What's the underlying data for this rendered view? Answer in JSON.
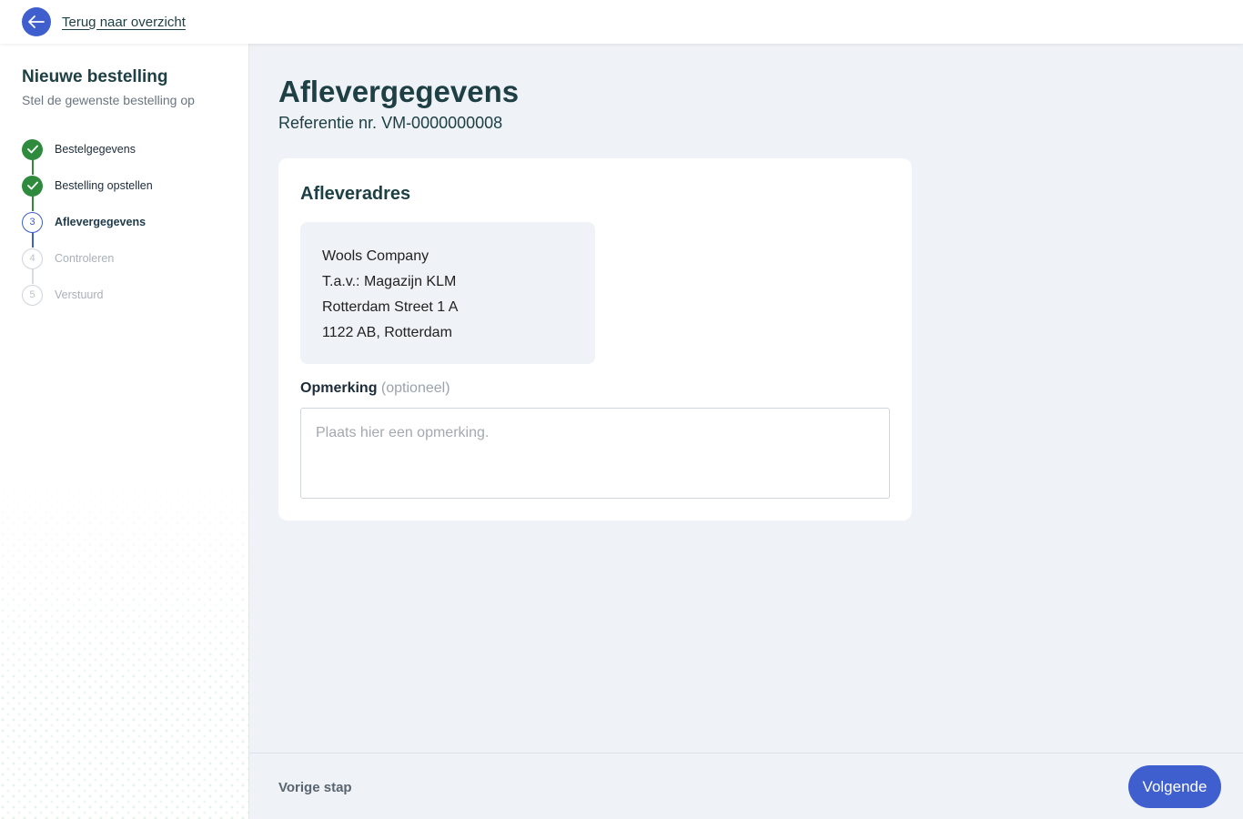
{
  "topbar": {
    "back_icon": "arrow-left-icon",
    "back_label": "Terug naar overzicht"
  },
  "sidebar": {
    "title": "Nieuwe bestelling",
    "subtitle": "Stel de gewenste bestelling op",
    "steps": [
      {
        "number": "1",
        "label": "Bestelgegevens",
        "status": "done"
      },
      {
        "number": "2",
        "label": "Bestelling opstellen",
        "status": "done"
      },
      {
        "number": "3",
        "label": "Aflevergegevens",
        "status": "active"
      },
      {
        "number": "4",
        "label": "Controleren",
        "status": "pending"
      },
      {
        "number": "5",
        "label": "Verstuurd",
        "status": "pending"
      }
    ]
  },
  "main": {
    "title": "Aflevergegevens",
    "reference": "Referentie nr. VM-0000000008",
    "card": {
      "title": "Afleveradres",
      "address": [
        "Wools Company",
        "T.a.v.: Magazijn KLM",
        "Rotterdam Street 1 A",
        "1122 AB, Rotterdam"
      ],
      "remark_label": "Opmerking",
      "remark_optional": "(optioneel)",
      "remark_value": "",
      "remark_placeholder": "Plaats hier een opmerking."
    }
  },
  "footer": {
    "prev_label": "Vorige stap",
    "next_label": "Volgende"
  },
  "colors": {
    "accent": "#3f5fcf",
    "done": "#2e8b3e",
    "heading": "#1e4045",
    "background": "#eff2f6"
  }
}
